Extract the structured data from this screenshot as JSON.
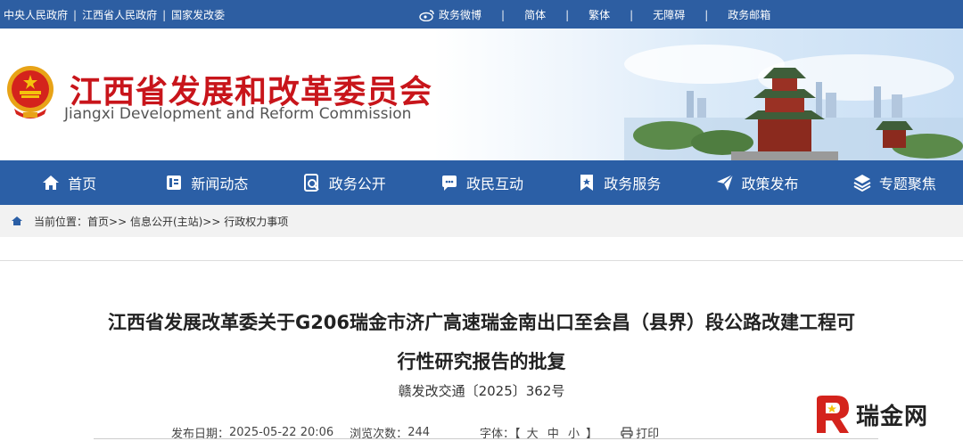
{
  "topbar": {
    "links_left": [
      "中央人民政府",
      "江西省人民政府",
      "国家发改委"
    ],
    "weibo": "政务微博",
    "simplified": "简体",
    "traditional": "繁体",
    "accessible": "无障碍",
    "mailbox": "政务邮箱"
  },
  "header": {
    "title": "江西省发展和改革委员会",
    "subtitle": "Jiangxi Development and Reform Commission"
  },
  "nav": {
    "items": [
      {
        "label": "首页",
        "icon": "home-icon"
      },
      {
        "label": "新闻动态",
        "icon": "news-icon"
      },
      {
        "label": "政务公开",
        "icon": "document-search-icon"
      },
      {
        "label": "政民互动",
        "icon": "chat-icon"
      },
      {
        "label": "政务服务",
        "icon": "bookmark-icon"
      },
      {
        "label": "政策发布",
        "icon": "send-icon"
      },
      {
        "label": "专题聚焦",
        "icon": "layers-icon"
      }
    ]
  },
  "breadcrumb": {
    "prefix": "当前位置：",
    "path": "首页>> 信息公开(主站)>> 行政权力事项"
  },
  "article": {
    "title_line1": "江西省发展改革委关于G206瑞金市济广高速瑞金南出口至会昌（县界）段公路改建工程可",
    "title_line2": "行性研究报告的批复",
    "doc_number": "赣发改交通〔2025〕362号",
    "publish_label": "发布日期：",
    "publish_date": "2025-05-22 20:06",
    "views_label": "浏览次数：",
    "views": "244",
    "font_label": "字体：【",
    "font_large": "大",
    "font_medium": "中",
    "font_small": "小",
    "font_end": "】",
    "print_label": "打印"
  },
  "watermark": {
    "text": "瑞金网"
  },
  "colors": {
    "topbar": "#2d5ea2",
    "nav": "#2b5fa6",
    "title_red": "#c8151b"
  }
}
